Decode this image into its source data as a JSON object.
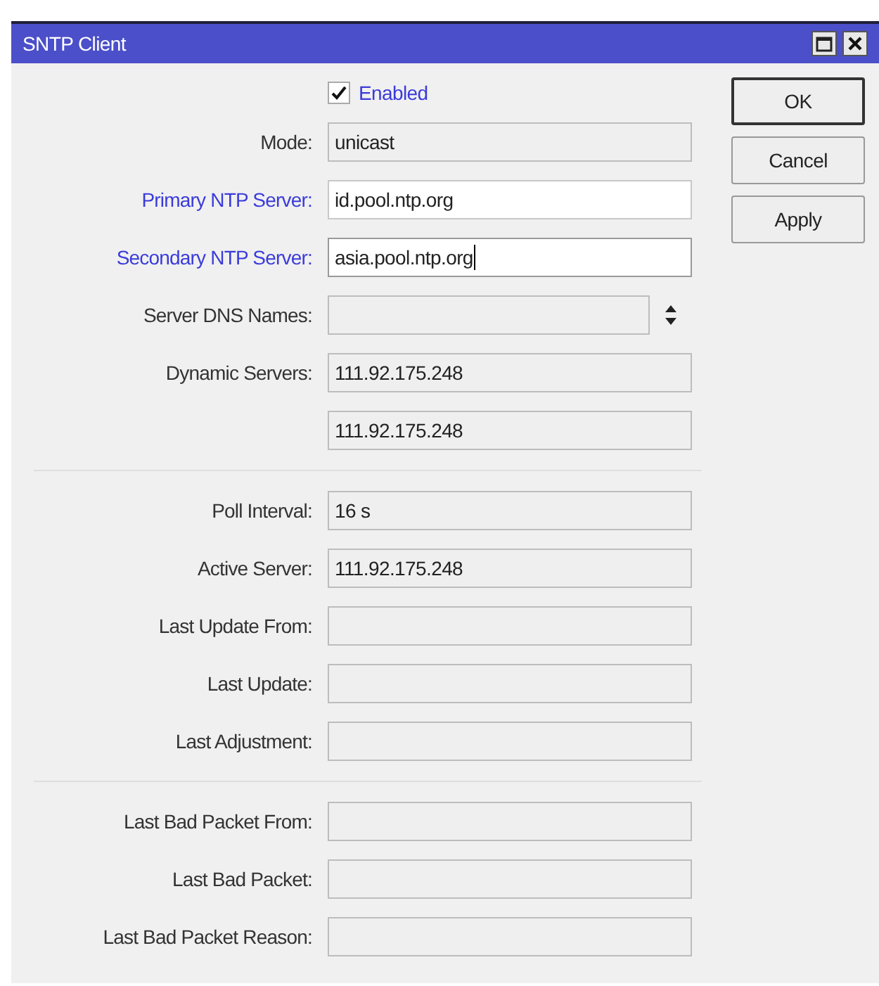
{
  "window": {
    "title": "SNTP Client"
  },
  "enabled": {
    "label": "Enabled",
    "checked": true
  },
  "sections": [
    {
      "rows": [
        {
          "label": "Mode:",
          "value": "unicast",
          "kind": "readonly",
          "highlighted": false
        },
        {
          "label": "Primary NTP Server:",
          "value": "id.pool.ntp.org",
          "kind": "editable",
          "highlighted": true,
          "focused": false
        },
        {
          "label": "Secondary NTP Server:",
          "value": "asia.pool.ntp.org",
          "kind": "editable",
          "highlighted": true,
          "focused": true
        },
        {
          "label": "Server DNS Names:",
          "kind": "spinner",
          "highlighted": false
        },
        {
          "label": "Dynamic Servers:",
          "value": "111.92.175.248",
          "kind": "readonly",
          "highlighted": false
        },
        {
          "value": "111.92.175.248",
          "kind": "readonly"
        }
      ]
    },
    {
      "rows": [
        {
          "label": "Poll Interval:",
          "value": "16 s",
          "kind": "readonly",
          "highlighted": false
        },
        {
          "label": "Active Server:",
          "value": "111.92.175.248",
          "kind": "readonly",
          "highlighted": false
        },
        {
          "label": "Last Update From:",
          "kind": "readonly",
          "highlighted": false
        },
        {
          "label": "Last Update:",
          "kind": "readonly",
          "highlighted": false
        },
        {
          "label": "Last Adjustment:",
          "kind": "readonly",
          "highlighted": false
        }
      ]
    },
    {
      "rows": [
        {
          "label": "Last Bad Packet From:",
          "kind": "readonly",
          "highlighted": false
        },
        {
          "label": "Last Bad Packet:",
          "kind": "readonly",
          "highlighted": false
        },
        {
          "label": "Last Bad Packet Reason:",
          "kind": "readonly",
          "highlighted": false
        }
      ]
    }
  ],
  "buttons": [
    {
      "label": "OK",
      "default": true
    },
    {
      "label": "Cancel",
      "default": false
    },
    {
      "label": "Apply",
      "default": false
    }
  ]
}
